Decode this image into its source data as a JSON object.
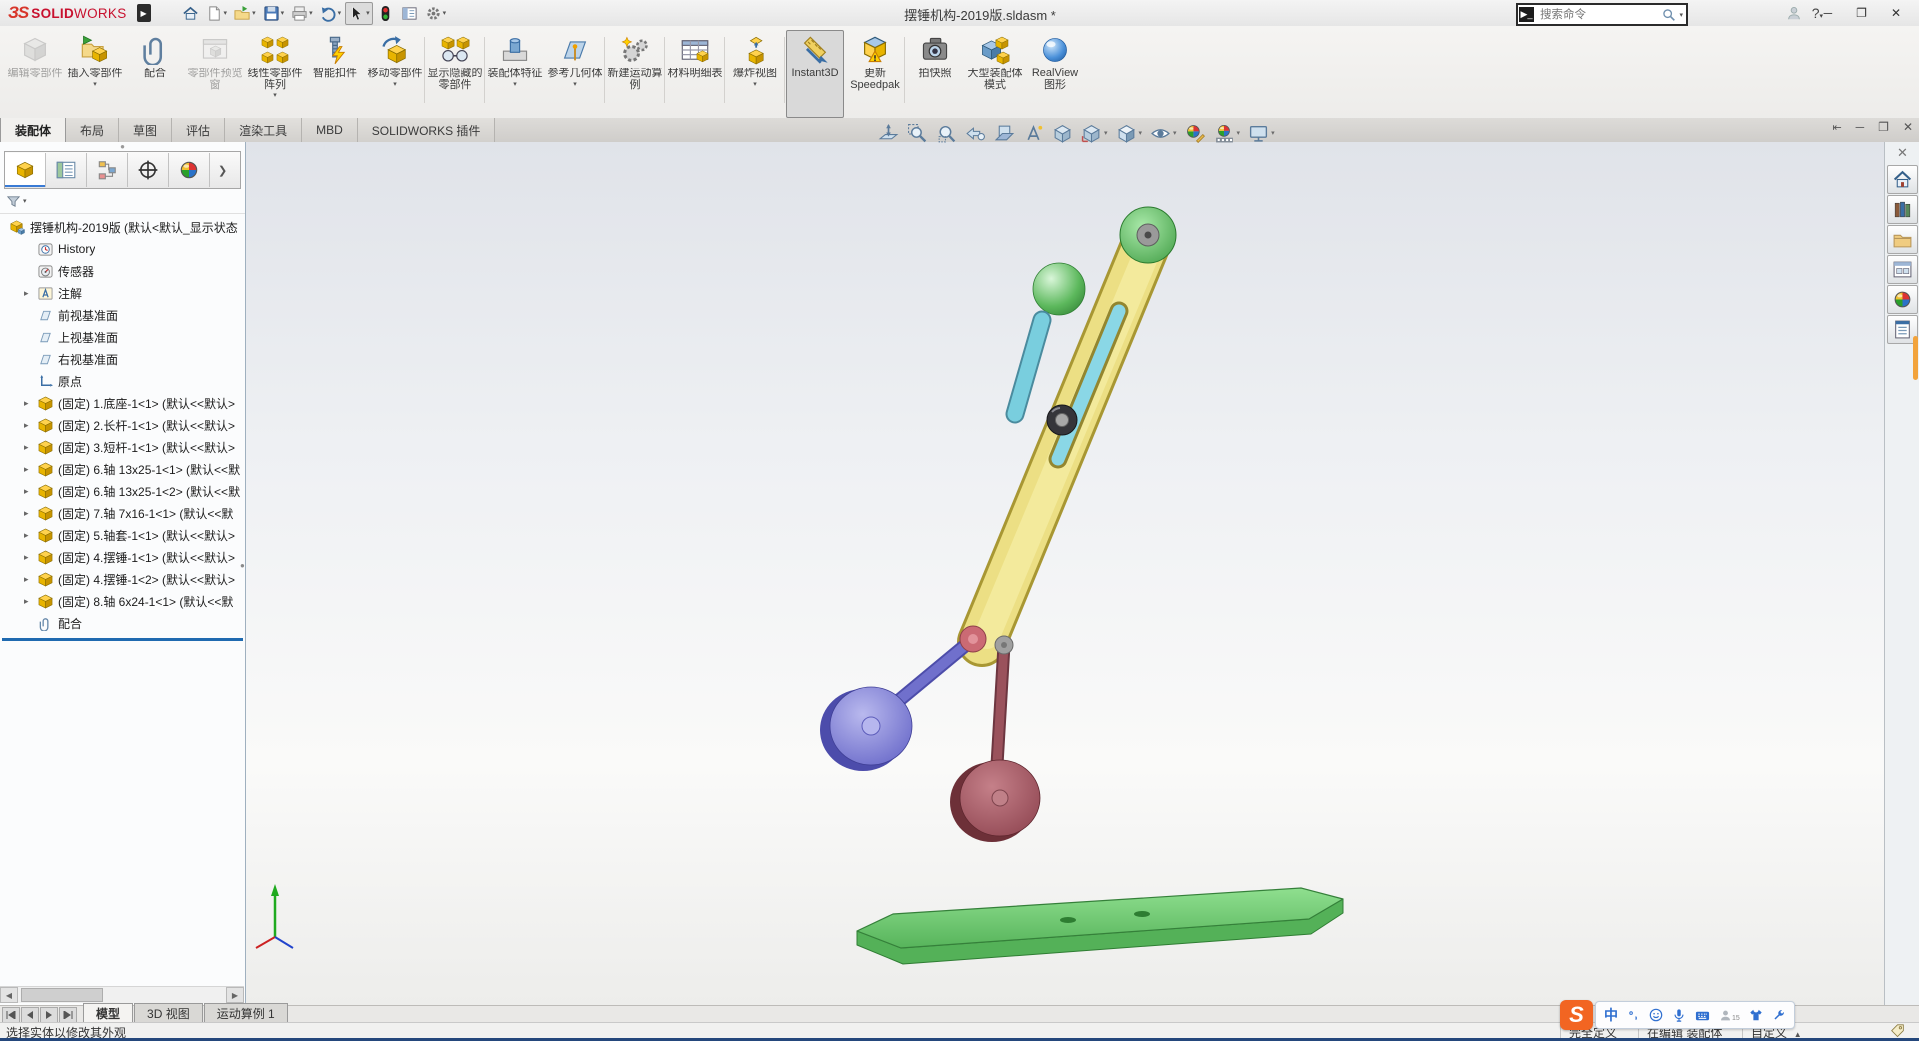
{
  "title_bar": {
    "logo_mark": "ЗS",
    "logo_bold": "SOLID",
    "logo_light": "WORKS",
    "document_title": "摆锤机构-2019版.sldasm *",
    "search_placeholder": "搜索命令",
    "help_label": "?",
    "tools": [
      {
        "icon": "home",
        "dd": false
      },
      {
        "icon": "new-document",
        "dd": true
      },
      {
        "icon": "open-document",
        "dd": true
      },
      {
        "icon": "save",
        "dd": true
      },
      {
        "icon": "print",
        "dd": true
      },
      {
        "icon": "undo",
        "dd": true
      },
      {
        "icon": "select-cursor",
        "dd": true,
        "pressed": true
      },
      {
        "icon": "traffic-light",
        "dd": false
      },
      {
        "icon": "document-list",
        "dd": false
      },
      {
        "icon": "settings-gear",
        "dd": true
      }
    ]
  },
  "ribbon": {
    "buttons": [
      {
        "label": "编辑零部件",
        "icon": "edit-component",
        "disabled": true
      },
      {
        "label": "插入零部件",
        "icon": "insert-component",
        "dd": true
      },
      {
        "label": "配合",
        "icon": "mate"
      },
      {
        "label": "零部件预览窗",
        "icon": "component-preview",
        "disabled": true
      },
      {
        "label": "线性零部件阵列",
        "icon": "linear-pattern",
        "dd": true
      },
      {
        "label": "智能扣件",
        "icon": "smart-fastener"
      },
      {
        "label": "移动零部件",
        "icon": "move-component",
        "dd": true,
        "sep": true
      },
      {
        "label": "显示隐藏的零部件",
        "icon": "show-hidden",
        "sep": true
      },
      {
        "label": "装配体特征",
        "icon": "assembly-features",
        "dd": true
      },
      {
        "label": "参考几何体",
        "icon": "reference-geometry",
        "dd": true,
        "sep": true
      },
      {
        "label": "新建运动算例",
        "icon": "motion-study",
        "sep": true
      },
      {
        "label": "材料明细表",
        "icon": "bom",
        "sep": true
      },
      {
        "label": "爆炸视图",
        "icon": "exploded-view",
        "dd": true,
        "sep": true
      },
      {
        "label": "Instant3D",
        "icon": "instant3d",
        "pressed": true
      },
      {
        "label": "更新Speedpak",
        "icon": "speedpak",
        "sep": true
      },
      {
        "label": "拍快照",
        "icon": "snapshot"
      },
      {
        "label": "大型装配体模式",
        "icon": "large-assembly"
      },
      {
        "label": "RealView图形",
        "icon": "realview"
      }
    ]
  },
  "command_tabs": {
    "labels": [
      "装配体",
      "布局",
      "草图",
      "评估",
      "渲染工具",
      "MBD",
      "SOLIDWORKS 插件"
    ],
    "active_index": 0
  },
  "feature_panel": {
    "tabs": [
      "featuremanager-tree",
      "propertymanager",
      "configurationmanager",
      "dimxpertmanager",
      "displaymanager"
    ],
    "rows": [
      {
        "label": "摆锤机构-2019版  (默认<默认_显示状态",
        "icon": "asm",
        "root": true
      },
      {
        "label": "History",
        "icon": "history"
      },
      {
        "label": "传感器",
        "icon": "sensor"
      },
      {
        "label": "注解",
        "icon": "annot",
        "exp": true
      },
      {
        "label": "前视基准面",
        "icon": "plane"
      },
      {
        "label": "上视基准面",
        "icon": "plane"
      },
      {
        "label": "右视基准面",
        "icon": "plane"
      },
      {
        "label": "原点",
        "icon": "origin"
      },
      {
        "label": "(固定) 1.底座-1<1> (默认<<默认>",
        "icon": "part",
        "exp": true
      },
      {
        "label": "(固定) 2.长杆-1<1> (默认<<默认>",
        "icon": "part",
        "exp": true
      },
      {
        "label": "(固定) 3.短杆-1<1> (默认<<默认>",
        "icon": "part",
        "exp": true
      },
      {
        "label": "(固定) 6.轴 13x25-1<1> (默认<<默",
        "icon": "part",
        "exp": true
      },
      {
        "label": "(固定) 6.轴 13x25-1<2> (默认<<默",
        "icon": "part",
        "exp": true
      },
      {
        "label": "(固定) 7.轴 7x16-1<1> (默认<<默",
        "icon": "part",
        "exp": true
      },
      {
        "label": "(固定) 5.轴套-1<1> (默认<<默认>",
        "icon": "part",
        "exp": true
      },
      {
        "label": "(固定) 4.摆锤-1<1> (默认<<默认>",
        "icon": "part",
        "exp": true
      },
      {
        "label": "(固定) 4.摆锤-1<2> (默认<<默认>",
        "icon": "part",
        "exp": true
      },
      {
        "label": "(固定) 8.轴 6x24-1<1> (默认<<默",
        "icon": "part",
        "exp": true
      },
      {
        "label": "配合",
        "icon": "mates"
      }
    ]
  },
  "heads_up": [
    {
      "icon": "zoom-fit"
    },
    {
      "icon": "zoom-area"
    },
    {
      "icon": "magnifier"
    },
    {
      "icon": "previous-view"
    },
    {
      "icon": "section-view"
    },
    {
      "icon": "annotation-view"
    },
    {
      "icon": "isometric"
    },
    {
      "icon": "view-orientation",
      "dd": true
    },
    {
      "icon": "display-style",
      "dd": true
    },
    {
      "icon": "hide-show",
      "dd": true
    },
    {
      "icon": "edit-appearance"
    },
    {
      "icon": "apply-scene",
      "dd": true
    },
    {
      "icon": "view-settings",
      "dd": true
    }
  ],
  "task_pane": [
    "home",
    "design-library",
    "file-explorer",
    "view-palette",
    "appearances",
    "custom-properties"
  ],
  "bottom_tabs": {
    "labels": [
      "模型",
      "3D 视图",
      "运动算例 1"
    ],
    "active_index": 0
  },
  "status_bar": {
    "message": "选择实体以修改其外观",
    "defined_state": "完全定义",
    "editing_state": "在编辑 装配体",
    "customize": "自定义"
  },
  "ime": {
    "logo": "S",
    "mode": "中",
    "badge": "15"
  },
  "model_colors": {
    "base_green": "#6fce6f",
    "rod_green": "#3f9b3f",
    "arm_yellow": "#ecdf84",
    "slider_cyan": "#8ad7e6",
    "pendulum_purple": "#7878d2",
    "pendulum_maroon": "#a3555f",
    "pin_gray": "#9a9a9a",
    "hub_dark": "#35353a"
  }
}
